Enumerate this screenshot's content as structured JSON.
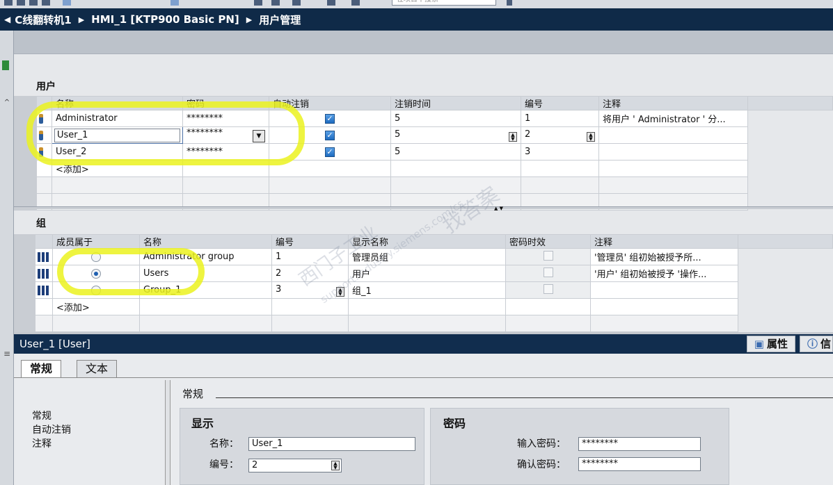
{
  "toolbar": {
    "search_placeholder": "在项目中搜索"
  },
  "breadcrumb": [
    "C线翻转机1",
    "HMI_1 [KTP900 Basic PN]",
    "用户管理"
  ],
  "users_section": {
    "title": "用户",
    "columns": [
      "名称",
      "密码",
      "自动注销",
      "注销时间",
      "编号",
      "注释"
    ],
    "rows": [
      {
        "name": "Administrator",
        "password": "********",
        "auto_logoff": true,
        "logoff_time": "5",
        "number": "1",
        "comment": "将用户 ' Administrator ' 分..."
      },
      {
        "name": "User_1",
        "password": "********",
        "auto_logoff": true,
        "logoff_time": "5",
        "number": "2",
        "comment": ""
      },
      {
        "name": "User_2",
        "password": "********",
        "auto_logoff": true,
        "logoff_time": "5",
        "number": "3",
        "comment": ""
      }
    ],
    "add_label": "<添加>"
  },
  "groups_section": {
    "title": "组",
    "columns": [
      "成员属于",
      "名称",
      "编号",
      "显示名称",
      "密码时效",
      "注释"
    ],
    "rows": [
      {
        "member": false,
        "name": "Administrator group",
        "number": "1",
        "display_name": "管理员组",
        "comment": "'管理员' 组初始被授予所..."
      },
      {
        "member": true,
        "name": "Users",
        "number": "2",
        "display_name": "用户",
        "comment": "'用户' 组初始被授予 '操作..."
      },
      {
        "member": false,
        "name": "Group_1",
        "number": "3",
        "display_name": "组_1",
        "comment": ""
      }
    ],
    "add_label": "<添加>"
  },
  "watermark": {
    "line1": "西门子工业",
    "line2": "找答案",
    "line3": "support.industry.siemens.com/cs"
  },
  "properties": {
    "title": "User_1 [User]",
    "right_tabs": [
      "属性",
      "信"
    ],
    "tabs": [
      "常规",
      "文本"
    ],
    "nav": [
      "常规",
      "自动注销",
      "注释"
    ],
    "section_label": "常规",
    "display_box": {
      "title": "显示",
      "name_label": "名称：",
      "name_value": "User_1",
      "number_label": "编号：",
      "number_value": "2"
    },
    "password_box": {
      "title": "密码",
      "enter_label": "输入密码：",
      "enter_value": "********",
      "confirm_label": "确认密码：",
      "confirm_value": "********"
    }
  },
  "colors": {
    "header_dark": "#0f2a48",
    "highlight": "#ebf21e",
    "check_blue": "#1e6bc0"
  }
}
